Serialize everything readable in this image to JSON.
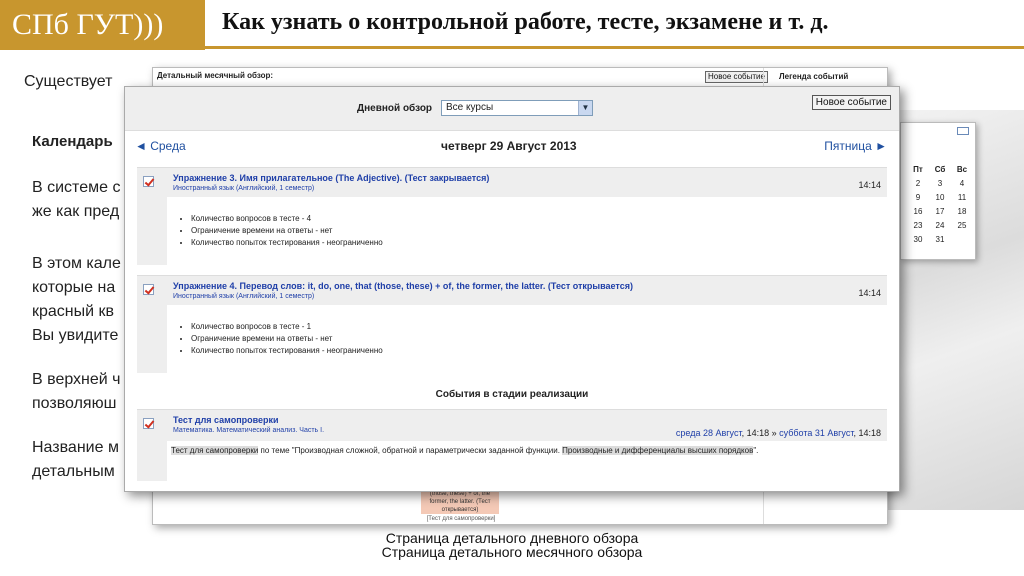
{
  "header": {
    "logo": "СПб ГУТ)))",
    "title": "Как узнать о контрольной работе, тесте, экзамене и т. д."
  },
  "slide": {
    "line1": "Существует",
    "heading": "Календарь",
    "p1a": "В системе с",
    "p1b": "же как пред",
    "p2a": "В этом кале",
    "p2b": "которые на",
    "p2c": "красный кв",
    "p2d": "Вы увидите",
    "p3a": "В верхней ч",
    "p3b": "позволяюш",
    "p4a": "Название м",
    "p4b": "детальным"
  },
  "month_window": {
    "title": "Детальный месячный обзор:",
    "new_event": "Новое событие",
    "legend": "Легенда событий",
    "event_text": "(those, these) + of, the former, the latter. (Тест открывается)",
    "link_text": "[Тест для самопроверки]"
  },
  "mini_calendar": {
    "headers": [
      "Пт",
      "Сб",
      "Вс"
    ],
    "rows": [
      [
        "2",
        "3",
        "4"
      ],
      [
        "9",
        "10",
        "11"
      ],
      [
        "16",
        "17",
        "18"
      ],
      [
        "23",
        "24",
        "25"
      ],
      [
        "30",
        "31",
        ""
      ]
    ]
  },
  "day_window": {
    "toolbar_label": "Дневной обзор",
    "course_select": "Все курсы",
    "new_event": "Новое событие",
    "prev": "◄ Среда",
    "next": "Пятница ►",
    "date": "четверг 29 Август 2013",
    "events": [
      {
        "title": "Упражнение 3. Имя прилагательное (The Adjective). (Тест закрывается)",
        "course": "Иностранный язык (Английский, 1 семестр)",
        "time": "14:14",
        "items": [
          "Количество вопросов в тесте - 4",
          "Ограничение времени на ответы - нет",
          "Количество попыток тестирования - неограниченно"
        ]
      },
      {
        "title": "Упражнение 4. Перевод слов: it, do, one, that (those, these) + of, the former, the latter. (Тест открывается)",
        "course": "Иностранный язык (Английский, 1 семестр)",
        "time": "14:14",
        "items": [
          "Количество вопросов в тесте - 1",
          "Ограничение времени на ответы - нет",
          "Количество попыток тестирования - неограниченно"
        ]
      }
    ],
    "section_title": "События в стадии реализации",
    "ongoing": {
      "title": "Тест для самопроверки",
      "course": "Математика. Математический анализ. Часть I.",
      "start_link": "среда 28 Август",
      "start_time": ", 14:18 » ",
      "end_link": "суббота 31 Август",
      "end_time": ", 14:18",
      "desc_link": "Тест для самопроверки",
      "desc_mid": " по теме \"Производная сложной, обратной и параметрически заданной функции. ",
      "desc_hl": "Производные и дифференциалы высших порядков",
      "desc_end": "\"."
    }
  },
  "captions": {
    "day": "Страница детального дневного обзора",
    "month": "Страница детального месячного обзора"
  }
}
